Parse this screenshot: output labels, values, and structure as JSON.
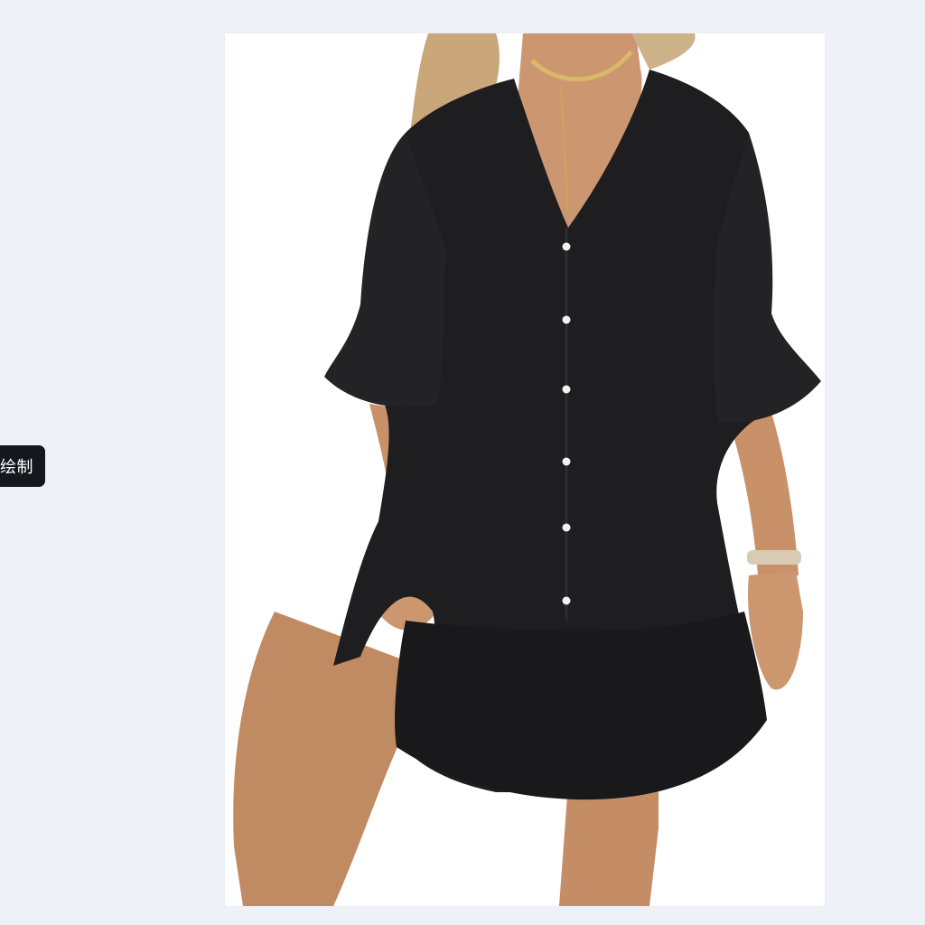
{
  "viewer": {
    "background": "#eef1f8",
    "side_tag": {
      "label": "绘制",
      "color": "#14171d"
    },
    "image": {
      "icon": "product-photo",
      "background": "#ffffff",
      "garment_color": "#1e1e20"
    }
  }
}
